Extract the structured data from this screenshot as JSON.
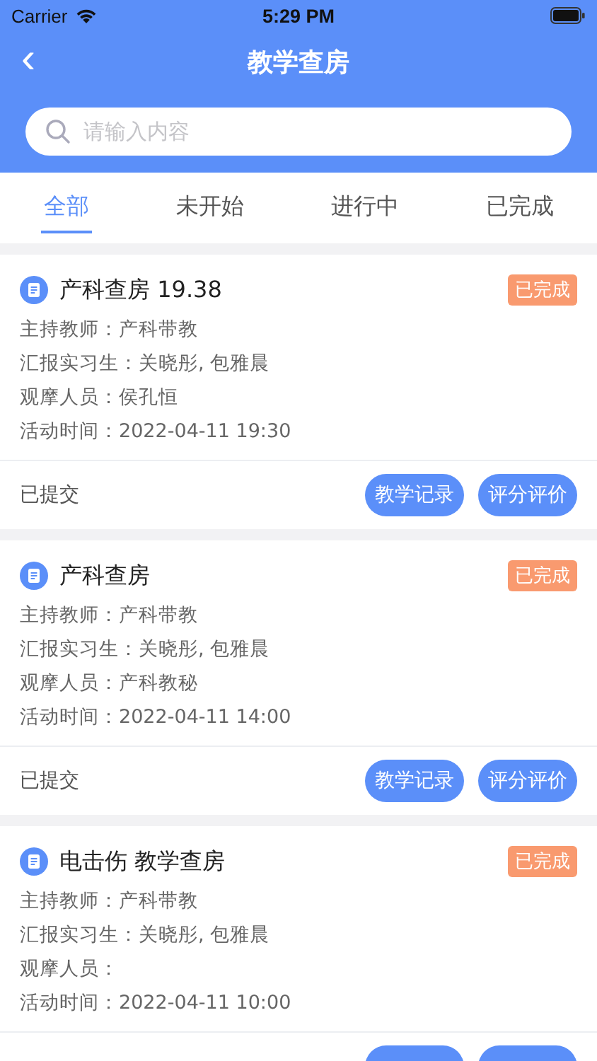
{
  "status_bar": {
    "carrier": "Carrier",
    "time": "5:29 PM"
  },
  "nav": {
    "back": "‹",
    "title": "教学查房"
  },
  "search": {
    "placeholder": "请输入内容"
  },
  "tabs": [
    {
      "label": "全部",
      "selected": true
    },
    {
      "label": "未开始",
      "selected": false
    },
    {
      "label": "进行中",
      "selected": false
    },
    {
      "label": "已完成",
      "selected": false
    }
  ],
  "cards": [
    {
      "title": "产科查房 19.38",
      "status": "已完成",
      "fields": [
        "主持教师：产科带教",
        "汇报实习生：关晓彤, 包雅晨",
        "观摩人员：侯孔恒",
        "活动时间：2022-04-11 19:30"
      ],
      "footer": {
        "kind": "full",
        "note": "已提交",
        "buttons": [
          "教学记录",
          "评分评价"
        ]
      }
    },
    {
      "title": "产科查房",
      "status": "已完成",
      "fields": [
        "主持教师：产科带教",
        "汇报实习生：关晓彤, 包雅晨",
        "观摩人员：产科教秘",
        "活动时间：2022-04-11 14:00"
      ],
      "footer": {
        "kind": "full",
        "note": "已提交",
        "buttons": [
          "教学记录",
          "评分评价"
        ]
      }
    },
    {
      "title": "电击伤 教学查房",
      "status": "已完成",
      "fields": [
        "主持教师：产科带教",
        "汇报实习生：关晓彤, 包雅晨",
        "观摩人员：",
        "活动时间：2022-04-11 10:00"
      ],
      "footer": {
        "kind": "cut"
      }
    }
  ]
}
